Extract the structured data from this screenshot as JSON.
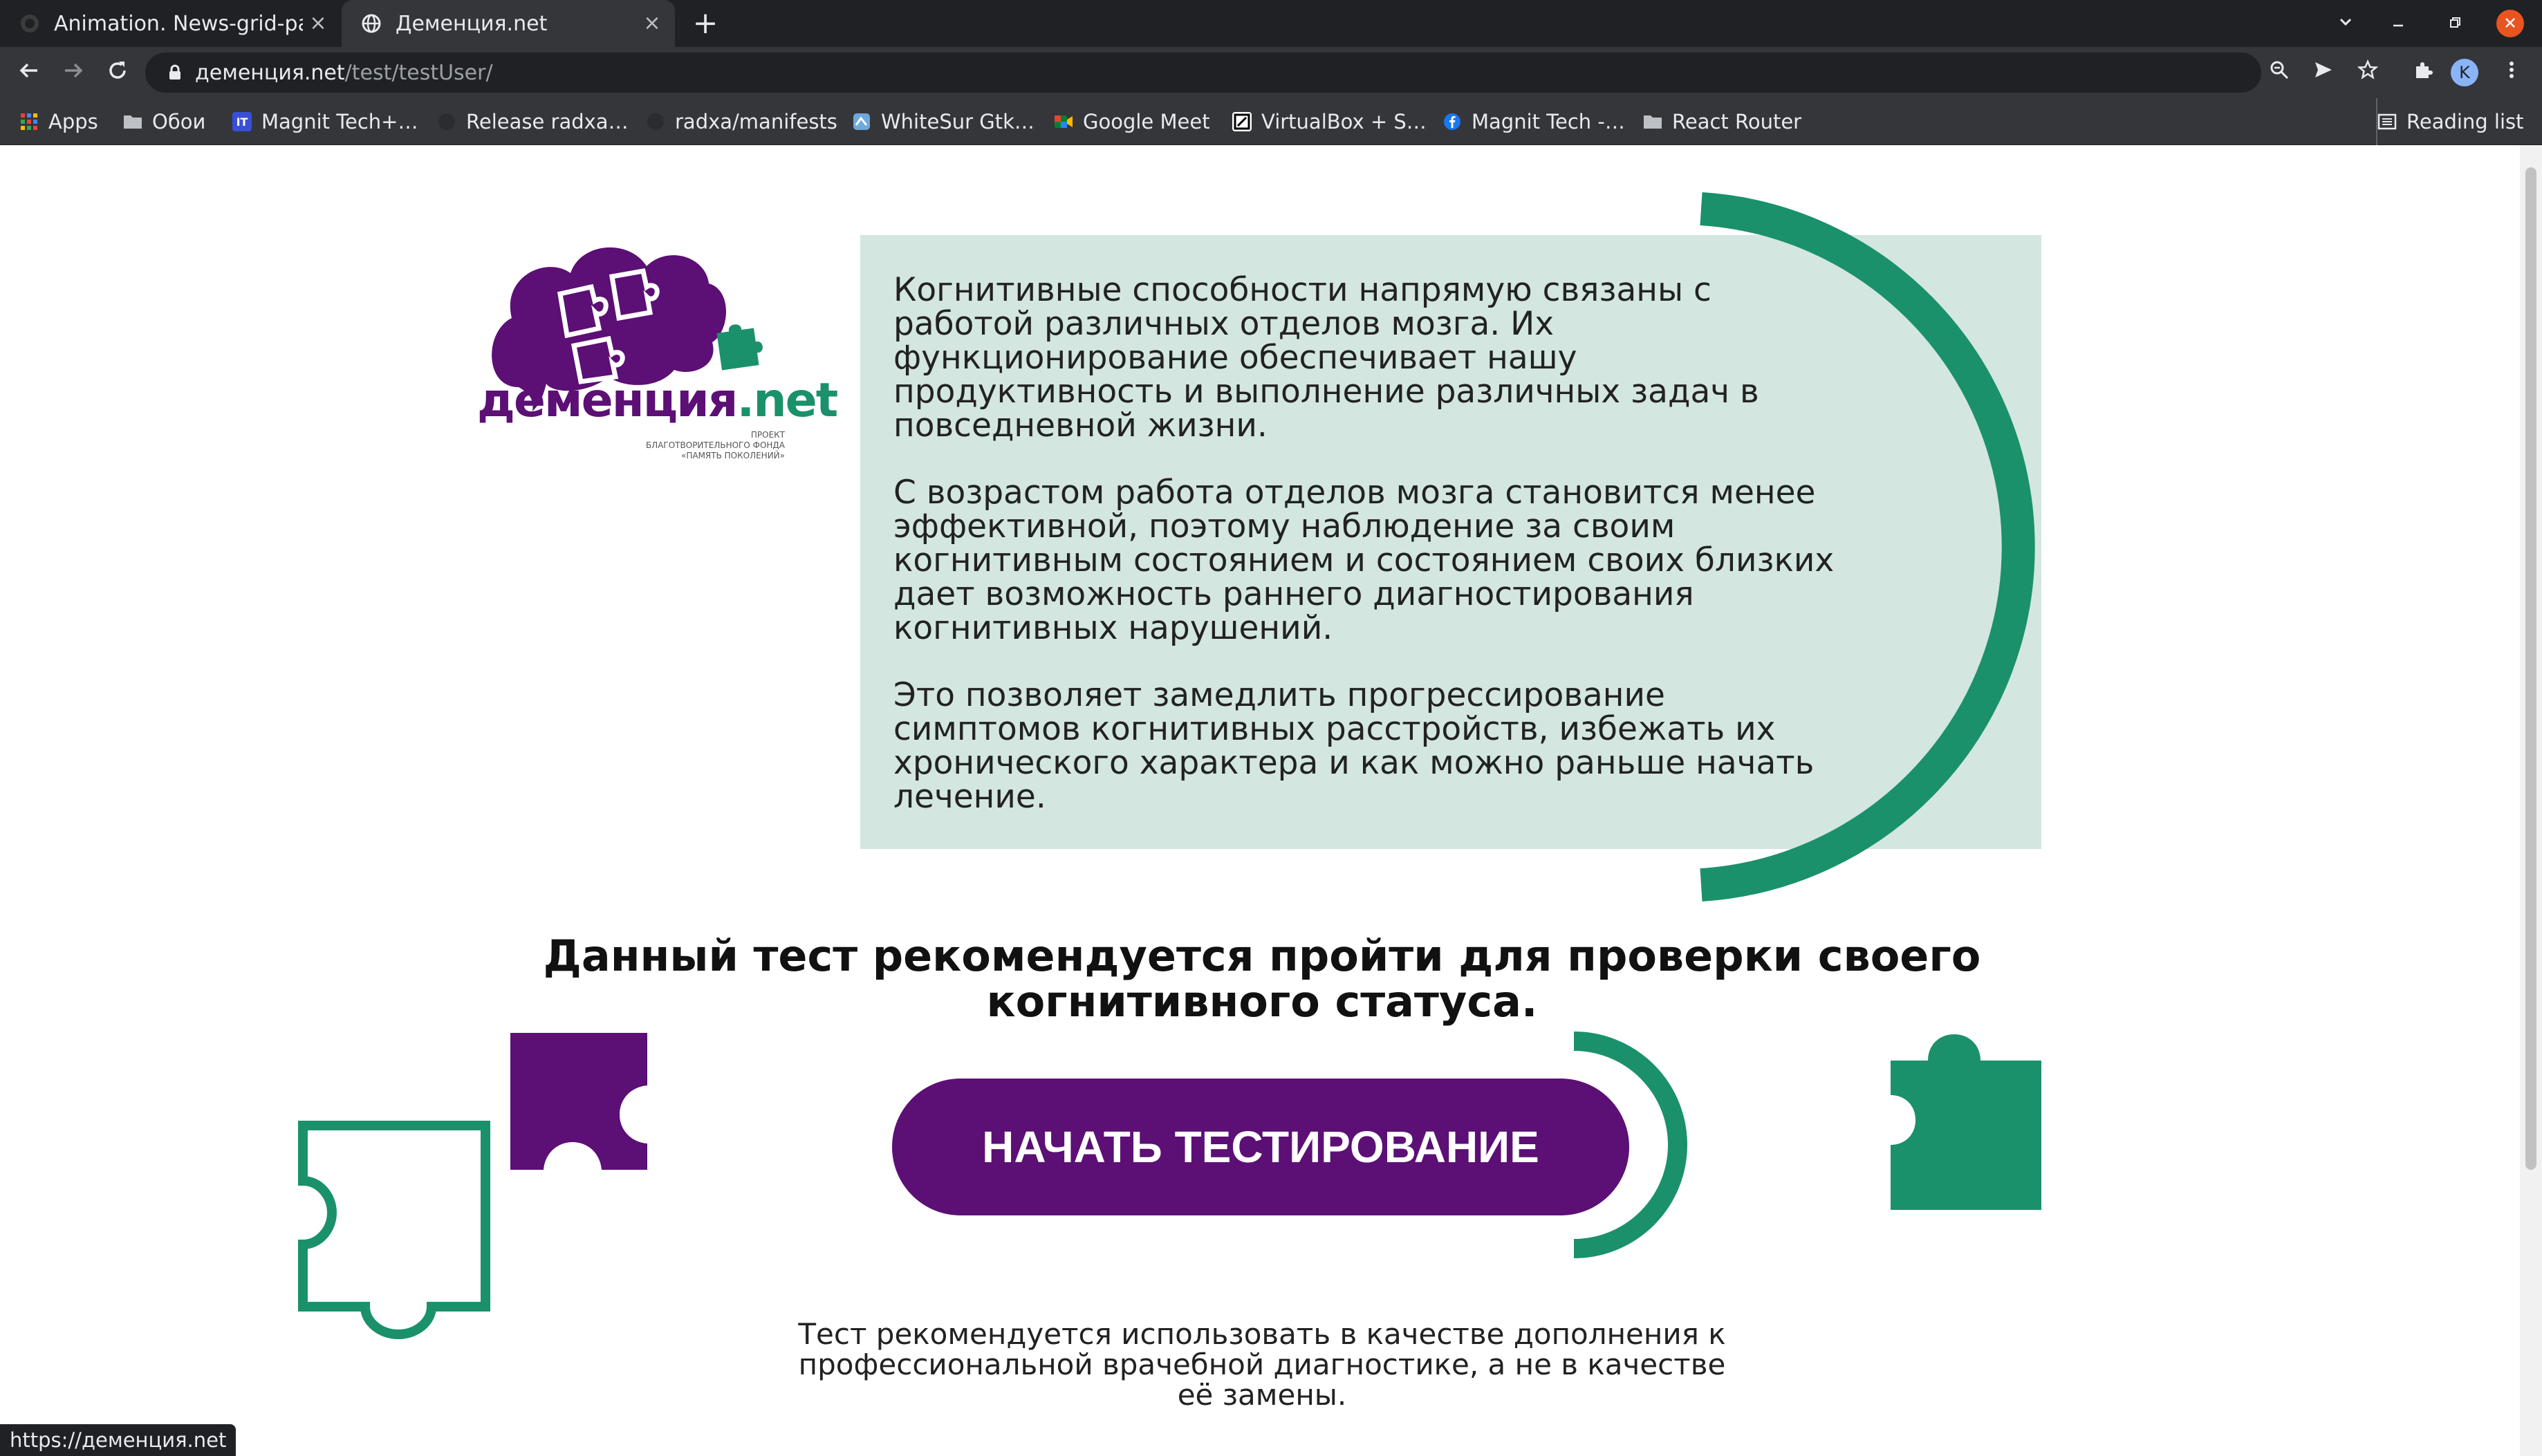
{
  "browser": {
    "tabs": [
      {
        "title": "Animation. News-grid-pag",
        "active": false
      },
      {
        "title": "Деменция.net",
        "active": true
      }
    ],
    "new_tab_symbol": "+",
    "close_symbol": "×",
    "url_host": "деменция.net",
    "url_path": "/test/testUser/",
    "avatar_letter": "K",
    "bookmarks": [
      {
        "label": "Apps",
        "icon": "apps-grid-icon"
      },
      {
        "label": "Обои",
        "icon": "folder-icon"
      },
      {
        "label": "Magnit Tech+…",
        "icon": "it-icon"
      },
      {
        "label": "Release radxa…",
        "icon": "github-icon"
      },
      {
        "label": "radxa/manifests",
        "icon": "github-icon"
      },
      {
        "label": "WhiteSur Gtk…",
        "icon": "whitesur-icon"
      },
      {
        "label": "Google Meet",
        "icon": "google-meet-icon"
      },
      {
        "label": "VirtualBox + S…",
        "icon": "virtualbox-icon"
      },
      {
        "label": "Magnit Tech -…",
        "icon": "facebook-icon"
      },
      {
        "label": "React Router",
        "icon": "folder-icon"
      }
    ],
    "reading_list": "Reading list",
    "status_url": "https://деменция.net"
  },
  "logo": {
    "word_main": "деменция",
    "word_suffix": ".net",
    "subtitle_line1": "ПРОЕКТ",
    "subtitle_line2": "БЛАГОТВОРИТЕЛЬНОГО ФОНДА",
    "subtitle_line3": "«ПАМЯТЬ ПОКОЛЕНИЙ»"
  },
  "info": {
    "paragraphs": [
      "Когнитивные способности напрямую связаны с работой различных отделов мозга. Их функционирование обеспечивает нашу продуктивность и выполнение различных задач в повседневной жизни.",
      "С возрастом работа отделов мозга становится менее эффективной, поэтому наблюдение за своим когнитивным состоянием и состоянием своих близких дает возможность раннего диагностирования когнитивных нарушений.",
      "Это позволяет замедлить прогрессирование симптомов когнитивных расстройств, избежать их хронического характера и как можно раньше начать лечение."
    ]
  },
  "headline": "Данный тест рекомендуется пройти для проверки своего когнитивного статуса.",
  "start_button": "НАЧАТЬ ТЕСТИРОВАНИЕ",
  "footnote": "Тест рекомендуется использовать в качестве дополнения к профессиональной врачебной диагностике, а не в качестве её замены.",
  "colors": {
    "brand_purple": "#5c0f75",
    "brand_green": "#1a916b",
    "info_background": "#d3e6e0"
  }
}
